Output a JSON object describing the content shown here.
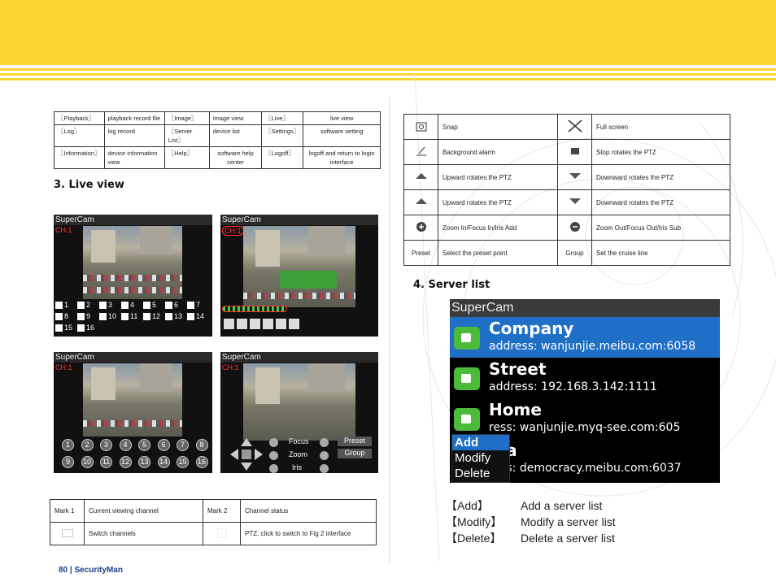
{
  "top_table": [
    [
      "〖Playback〗",
      "playback record file",
      "〖Image〗",
      "image view",
      "〖Live〗",
      "live view"
    ],
    [
      "〖Log〗",
      "log record",
      "〖Server List〗",
      "device list",
      "〖Settings〗",
      "software setting"
    ],
    [
      "〖Information〗",
      "device information view",
      "〖Help〗",
      "software help center",
      "〖Logoff〗",
      "logoff and return to login interface"
    ]
  ],
  "live_view_heading": "3. Live view",
  "server_list_heading": "4. Server list",
  "screens": {
    "app_title": "SuperCam",
    "channel": "CH:1",
    "channels": [
      "1",
      "2",
      "3",
      "4",
      "5",
      "6",
      "7",
      "8",
      "9",
      "10",
      "11",
      "12",
      "13",
      "14",
      "15",
      "16"
    ],
    "ptz_labels": [
      "Focus",
      "Zoom",
      "Iris"
    ],
    "ptz_buttons": [
      "Preset",
      "Group"
    ]
  },
  "mark_table": {
    "mark1": "Mark 1",
    "mark1_desc": "Current viewing channel",
    "mark2": "Mark 2",
    "mark2_desc": "Channel status",
    "row2_left": "Switch channels",
    "row2_right": "PTZ, click to switch to Fig 2 interface"
  },
  "ptz_table": [
    {
      "icon": "snap-icon",
      "label": "Snap",
      "icon2": "fullscreen-icon",
      "label2": "Full screen"
    },
    {
      "icon": "background-alarm-icon",
      "label": "Background  alarm",
      "icon2": "stop-ptz-icon",
      "label2": "Stop rotates the PTZ"
    },
    {
      "icon": "up-arrow-icon",
      "label": "Upward rotates the PTZ",
      "icon2": "down-arrow-icon",
      "label2": "Downward rotates the PTZ"
    },
    {
      "icon": "up-arrow-icon",
      "label": "Upward rotates the PTZ",
      "icon2": "down-arrow-icon",
      "label2": "Downward rotates the PTZ"
    },
    {
      "icon": "plus-icon",
      "label": "Zoom In/Focus In/Iris Add",
      "icon2": "minus-icon",
      "label2": "Zoom Out/Focus Out/Iris Sub"
    },
    {
      "icon": "",
      "icon_text": "Preset",
      "label": "Select the preset point",
      "icon2": "",
      "icon2_text": "Group",
      "label2": "Set the cruise line"
    }
  ],
  "server_list": {
    "title": "SuperCam",
    "servers": [
      {
        "name": "Company",
        "address": "address: wanjunjie.meibu.com:6058"
      },
      {
        "name": "Street",
        "address": "address: 192.168.3.142:1111"
      },
      {
        "name": "Home",
        "address": "ress: wanjunjie.myq-see.com:605"
      },
      {
        "name": "ina",
        "address": "ress: democracy.meibu.com:6037"
      }
    ],
    "menu": [
      "Add",
      "Modify",
      "Delete"
    ]
  },
  "legend": [
    {
      "key": "【Add】",
      "desc": "Add a server list"
    },
    {
      "key": "【Modify】",
      "desc": "Modify a server list"
    },
    {
      "key": "【Delete】",
      "desc": "Delete a server list"
    }
  ],
  "footer": "80  |  SecurityMan",
  "colors": {
    "banner": "#fcd434",
    "selected": "#1f6fc7",
    "footer": "#1a3c8a"
  }
}
